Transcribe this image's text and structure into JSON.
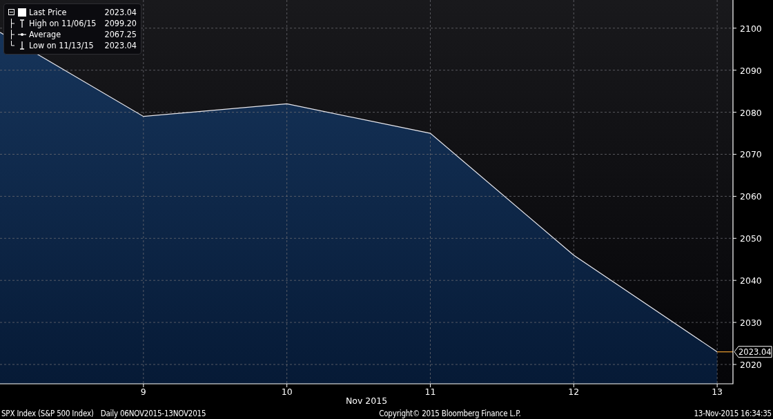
{
  "legend": [
    {
      "kind": "last",
      "label": "Last Price",
      "value": "2023.04"
    },
    {
      "kind": "high",
      "label": "High on 11/06/15",
      "value": "2099.20"
    },
    {
      "kind": "average",
      "label": "Average",
      "value": "2067.25"
    },
    {
      "kind": "low",
      "label": "Low on 11/13/15",
      "value": "2023.04"
    }
  ],
  "chart": {
    "last_price_tag": "2023.04",
    "chart_data": {
      "type": "area",
      "grid": true,
      "xlabel": "Nov 2015",
      "categories": [
        null,
        "9",
        "10",
        "11",
        "12",
        "13"
      ],
      "series": [
        {
          "color": "#16345a",
          "values": [
            2099,
            2079,
            2082,
            2075,
            2046,
            2023
          ]
        }
      ],
      "ylim": [
        2015.4,
        2106.7
      ],
      "yticks": [
        2020,
        2030,
        2040,
        2050,
        2060,
        2070,
        2080,
        2090,
        2100
      ]
    }
  },
  "footer": {
    "security": "SPX Index (S&P 500 Index)",
    "range": "Daily 06NOV2015-13NOV2015",
    "copyright": "Copyright© 2015 Bloomberg Finance L.P.",
    "timestamp": "13-Nov-2015 16:34:35"
  }
}
